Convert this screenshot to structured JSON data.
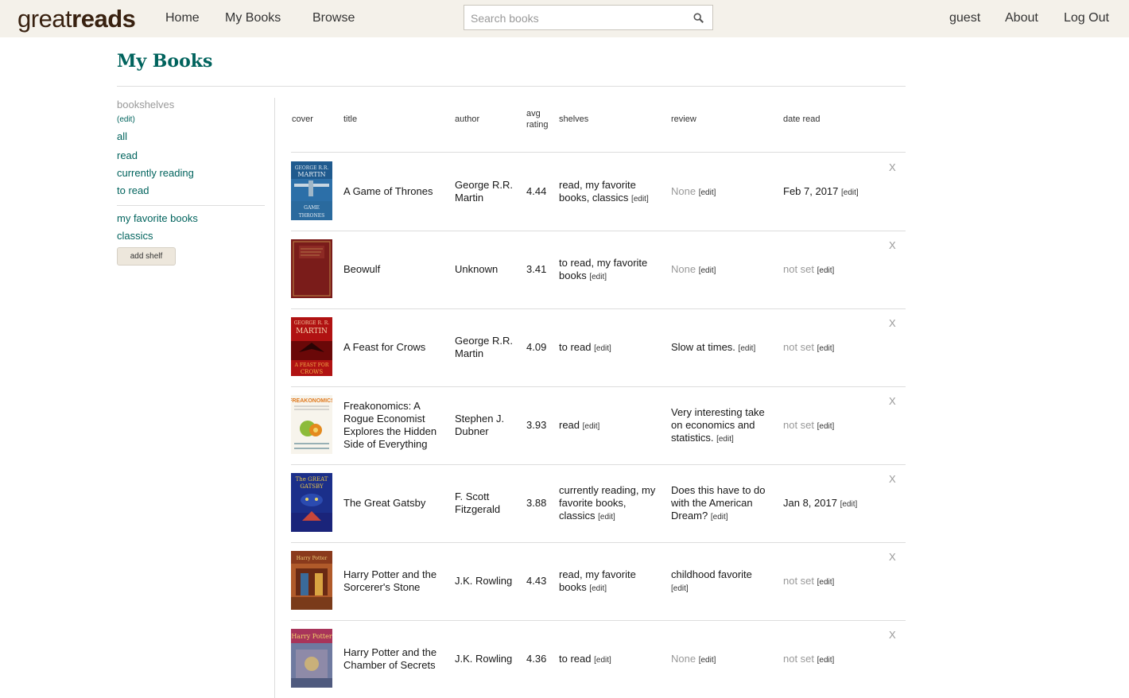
{
  "header": {
    "logo_regular": "great",
    "logo_bold": "reads",
    "nav": [
      "Home",
      "My Books",
      "Browse"
    ],
    "search_placeholder": "Search books",
    "right_nav": [
      "guest",
      "About",
      "Log Out"
    ]
  },
  "page_title": "My Books",
  "sidebar": {
    "heading": "bookshelves",
    "heading_edit": "(edit)",
    "default_shelves": [
      "all",
      "read",
      "currently reading",
      "to read"
    ],
    "custom_shelves": [
      "my favorite books",
      "classics"
    ],
    "add_shelf_label": "add shelf"
  },
  "table": {
    "headers": {
      "cover": "cover",
      "title": "title",
      "author": "author",
      "avg_rating_line1": "avg",
      "avg_rating_line2": "rating",
      "shelves": "shelves",
      "review": "review",
      "date_read": "date read"
    },
    "edit_label": "[edit]",
    "remove_label": "X",
    "rows": [
      {
        "cover_text": "GEORGE R.R. MARTIN / A GAME OF THRONES",
        "title": "A Game of Thrones",
        "author": "George R.R. Martin",
        "avg_rating": "4.44",
        "shelves": "read, my favorite books, classics",
        "review": "None",
        "date_read": "Feb 7, 2017"
      },
      {
        "cover_text": "",
        "title": "Beowulf",
        "author": "Unknown",
        "avg_rating": "3.41",
        "shelves": "to read, my favorite books",
        "review": "None",
        "date_read": "not set"
      },
      {
        "cover_text": "GEORGE R. R. MARTIN / A FEAST FOR CROWS",
        "title": "A Feast for Crows",
        "author": "George R.R. Martin",
        "avg_rating": "4.09",
        "shelves": "to read",
        "review": "Slow at times.",
        "date_read": "not set"
      },
      {
        "cover_text": "FREAKONOMICS",
        "title": "Freakonomics: A Rogue Economist Explores the Hidden Side of Everything",
        "author": "Stephen J. Dubner",
        "avg_rating": "3.93",
        "shelves": "read",
        "review": "Very interesting take on economics and statistics.",
        "date_read": "not set"
      },
      {
        "cover_text": "The GREAT GATSBY",
        "title": "The Great Gatsby",
        "author": "F. Scott Fitzgerald",
        "avg_rating": "3.88",
        "shelves": "currently reading, my favorite books, classics",
        "review": "Does this have to do with the American Dream?",
        "date_read": "Jan 8, 2017"
      },
      {
        "cover_text": "",
        "title": "Harry Potter and the Sorcerer's Stone",
        "author": "J.K. Rowling",
        "avg_rating": "4.43",
        "shelves": "read, my favorite books",
        "review": "childhood favorite",
        "date_read": "not set"
      },
      {
        "cover_text": "Harry Potter",
        "title": "Harry Potter and the Chamber of Secrets",
        "author": "J.K. Rowling",
        "avg_rating": "4.36",
        "shelves": "to read",
        "review": "None",
        "date_read": "not set"
      }
    ]
  },
  "colors": {
    "topbar_bg": "#f4f1ea",
    "logo": "#382110",
    "accent_teal": "#00635d",
    "muted": "#999999"
  }
}
